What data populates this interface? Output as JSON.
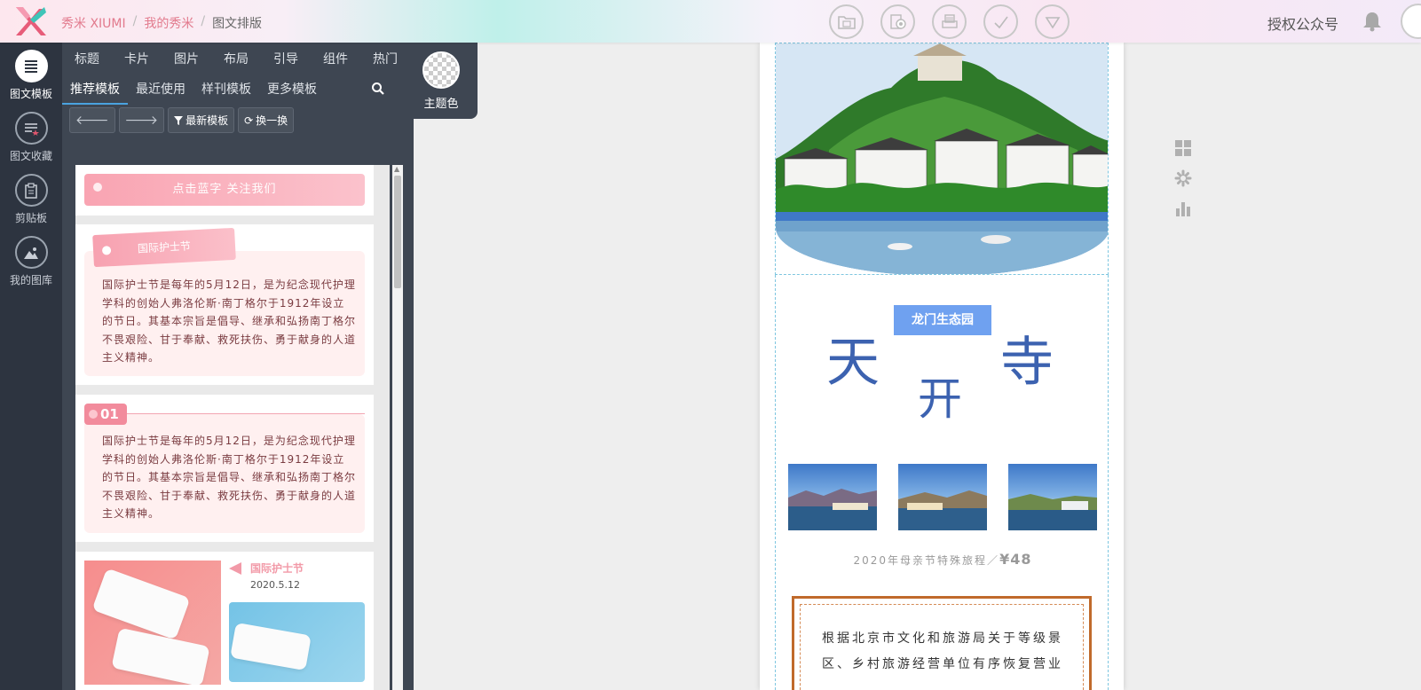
{
  "breadcrumb": {
    "home": "秀米 XIUMI",
    "mine": "我的秀米",
    "current": "图文排版",
    "sep": "/"
  },
  "header": {
    "auth_label": "授权公众号"
  },
  "toolbar_icons": [
    "folder-icon",
    "preview-icon",
    "print-icon",
    "check-icon",
    "triangle-icon"
  ],
  "rail": [
    {
      "label": "图文模板",
      "icon": "template-icon",
      "active": true
    },
    {
      "label": "图文收藏",
      "icon": "favorites-icon",
      "active": false
    },
    {
      "label": "剪贴板",
      "icon": "clipboard-icon",
      "active": false
    },
    {
      "label": "我的图库",
      "icon": "gallery-icon",
      "active": false
    }
  ],
  "categories": [
    "标题",
    "卡片",
    "图片",
    "布局",
    "引导",
    "组件",
    "热门"
  ],
  "sub_tabs": [
    "推荐模板",
    "最近使用",
    "样刊模板",
    "更多模板"
  ],
  "theme": {
    "label": "主题色"
  },
  "panel_buttons": {
    "latest": "最新模板",
    "shuffle": "换一换"
  },
  "cards": {
    "banner_text": "点击蓝字 关注我们",
    "nurse_tag": "国际护士节",
    "paragraph": "国际护士节是每年的5月12日，是为纪念现代护理学科的创始人弗洛伦斯·南丁格尔于1912年设立的节日。其基本宗旨是倡导、继承和弘扬南丁格尔不畏艰险、甘于奉献、救死扶伤、勇于献身的人道主义精神。",
    "number_tag": "01",
    "photo_title": "国际护士节",
    "photo_date": "2020.5.12"
  },
  "preview": {
    "park_tag": "龙门生态园",
    "char_left": "天",
    "char_mid": "开",
    "char_right": "寺",
    "price_text": "2020年母亲节特殊旅程／",
    "price_value": "¥48",
    "notice": "根据北京市文化和旅游局关于等级景区、乡村旅游经营单位有序恢复营业"
  },
  "colors": {
    "accent": "#e27a8d",
    "rail_bg": "#2d3440",
    "panel_bg": "#3e4652",
    "title_blue": "#3c62b0",
    "tag_blue": "#6fa1f0",
    "border_orange": "#c06a2b"
  }
}
